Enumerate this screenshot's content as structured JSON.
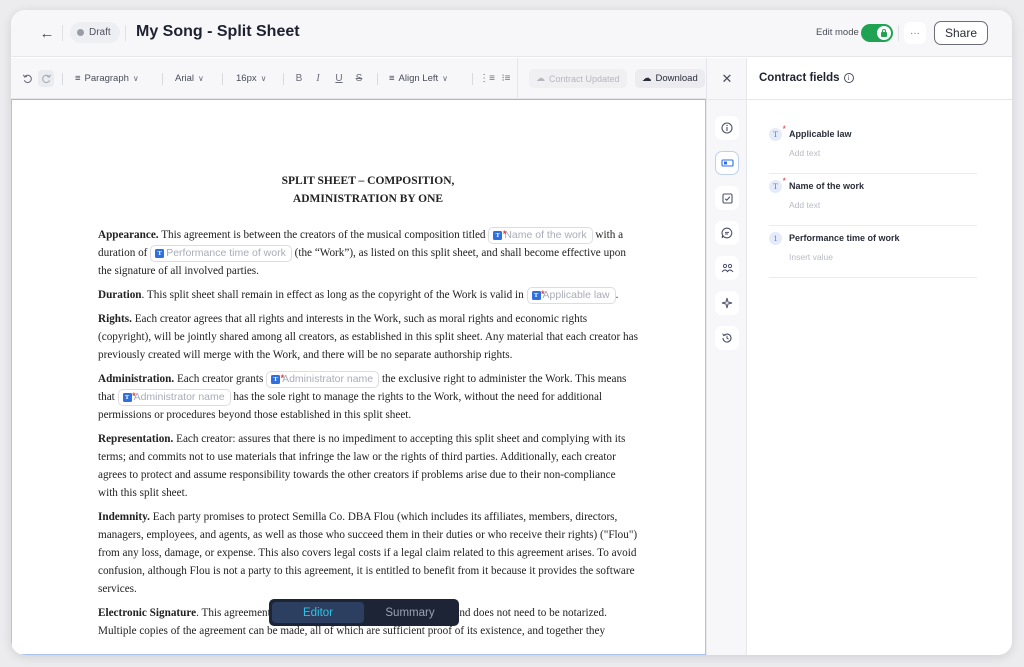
{
  "header": {
    "back_icon": "arrow-left-icon",
    "status_badge": "Draft",
    "title": "My Song - Split Sheet",
    "edit_mode_label": "Edit mode",
    "edit_mode_on": true,
    "more_label": "···",
    "share_label": "Share"
  },
  "toolbar": {
    "undo_icon": "undo-icon",
    "redo_icon": "redo-icon",
    "block_type": "Paragraph",
    "font_family": "Arial",
    "font_size": "16px",
    "bold": "B",
    "italic": "I",
    "underline": "U",
    "strikethrough": "S",
    "align": "Align Left",
    "contract_updated_label": "Contract Updated",
    "download_label": "Download"
  },
  "document": {
    "title_line1": "SPLIT SHEET – COMPOSITION,",
    "title_line2": "ADMINISTRATION BY ONE",
    "appearance": {
      "heading": "Appearance.",
      "t1": " This agreement is between the creators of the musical composition titled ",
      "chip1": "Name of the work",
      "t2": " with a duration of ",
      "chip2": "Performance time of work",
      "t3": " (the “Work”), as listed on this split sheet, and shall become effective upon the signature of all involved parties."
    },
    "duration": {
      "heading": "Duration",
      "t1": ". This split sheet shall remain in effect as long as the copyright of the Work is valid in ",
      "chip1": "Applicable law",
      "t2": "."
    },
    "rights": {
      "heading": "Rights.",
      "t1": " Each creator agrees that all rights and interests in the Work, such as moral rights and economic rights (copyright), will be jointly shared among all creators, as established in this split sheet. Any material that each creator has previously created will merge with the Work, and there will be no separate authorship rights."
    },
    "administration": {
      "heading": "Administration.",
      "t1": " Each creator grants ",
      "chip1": "Administrator name",
      "t2": " the exclusive right to administer the Work. This means that ",
      "chip2": "Administrator name",
      "t3": " has the sole right to manage the rights to the Work, without the need for additional permissions or procedures beyond those established in this split sheet."
    },
    "representation": {
      "heading": "Representation.",
      "t1": " Each creator: assures that there is no impediment to accepting this split sheet and complying with its terms; and commits not to use materials that infringe the law or the rights of third parties. Additionally, each creator agrees to protect and assume responsibility towards the other creators if problems arise due to their non-compliance with this split sheet."
    },
    "indemnity": {
      "heading": "Indemnity.",
      "t1": " Each party promises to protect Semilla Co. DBA Flou (which includes its affiliates, members, directors, managers, employees, and agents, as well as those who succeed them in their duties or who receive their rights) (\"Flou\") from any loss, damage, or expense. This also covers legal costs if a legal claim related to this agreement arises. To avoid confusion, although Flou is not a party to this agreement, it is entitled to benefit from it because it provides the software services."
    },
    "signature": {
      "heading": "Electronic Signature",
      "t1": ". This agreement can be signed electronically or by hand, and does not need to be notarized. Multiple copies of the agreement can be made, all of which are sufficient proof of its existence, and together they"
    }
  },
  "view_switcher": {
    "editor_label": "Editor",
    "summary_label": "Summary",
    "active": "Editor"
  },
  "rail": {
    "close_icon": "close-icon",
    "items": [
      "info-icon",
      "fields-icon",
      "checklist-icon",
      "comments-icon",
      "participants-icon",
      "ai-sparkle-icon",
      "history-icon"
    ],
    "active": "fields-icon"
  },
  "panel": {
    "title": "Contract fields",
    "fields": [
      {
        "badge": "T",
        "required": true,
        "label": "Applicable law",
        "placeholder": "Add text"
      },
      {
        "badge": "T",
        "required": true,
        "label": "Name of the work",
        "placeholder": "Add text"
      },
      {
        "badge": "1",
        "required": false,
        "label": "Performance time of work",
        "placeholder": "Insert value"
      }
    ]
  },
  "colors": {
    "accent_blue": "#2f6fe0",
    "toggle_green": "#1fa352",
    "required_red": "#e23b3b",
    "switcher_bg": "#1d2435",
    "switcher_active_text": "#2ec4e6"
  }
}
